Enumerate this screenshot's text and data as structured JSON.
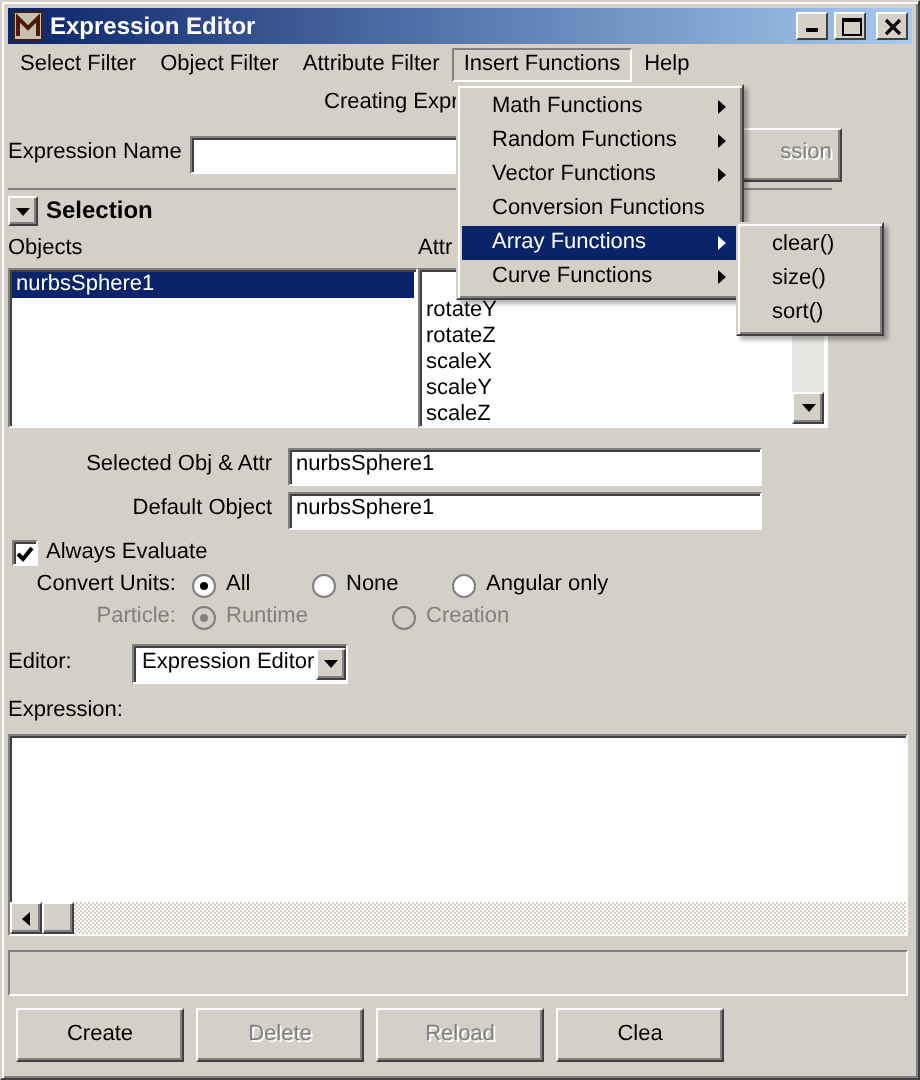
{
  "window": {
    "title": "Expression Editor"
  },
  "menu_bar": [
    {
      "label": "Select Filter",
      "selected": false
    },
    {
      "label": "Object Filter",
      "selected": false
    },
    {
      "label": "Attribute Filter",
      "selected": false
    },
    {
      "label": "Insert Functions",
      "selected": true
    },
    {
      "label": "Help",
      "selected": false
    }
  ],
  "heading": "Creating Expr",
  "expression_name": {
    "label": "Expression Name"
  },
  "action_button": {
    "label": "ssion",
    "disabled": true
  },
  "selection": {
    "title": "Selection",
    "expanded": true
  },
  "objects": {
    "label": "Objects",
    "items": [
      {
        "label": "nurbsSphere1",
        "selected": true
      }
    ]
  },
  "attributes": {
    "label": "Attr",
    "items": [
      {
        "label": "rotateY",
        "selected": false
      },
      {
        "label": "rotateZ",
        "selected": false
      },
      {
        "label": "scaleX",
        "selected": false
      },
      {
        "label": "scaleY",
        "selected": false
      },
      {
        "label": "scaleZ",
        "selected": false
      }
    ]
  },
  "fields": [
    {
      "label": "Selected Obj & Attr",
      "value": "nurbsSphere1"
    },
    {
      "label": "Default Object",
      "value": "nurbsSphere1"
    }
  ],
  "always_evaluate": {
    "label": "Always Evaluate",
    "checked": true
  },
  "convert_units": {
    "label": "Convert Units:",
    "disabled": false,
    "options": [
      {
        "label": "All",
        "selected": true
      },
      {
        "label": "None",
        "selected": false
      },
      {
        "label": "Angular only",
        "selected": false
      }
    ]
  },
  "particle": {
    "label": "Particle:",
    "disabled": true,
    "options": [
      {
        "label": "Runtime",
        "selected": true
      },
      {
        "label": "Creation",
        "selected": false
      }
    ]
  },
  "editor": {
    "label": "Editor:",
    "value": "Expression Editor"
  },
  "expression": {
    "label": "Expression:"
  },
  "buttons": [
    {
      "label": "Create",
      "disabled": false
    },
    {
      "label": "Delete",
      "disabled": true
    },
    {
      "label": "Reload",
      "disabled": true
    },
    {
      "label": "Clea",
      "disabled": false
    }
  ],
  "insert_functions_menu": [
    {
      "label": "Math Functions",
      "selected": false
    },
    {
      "label": "Random Functions",
      "selected": false
    },
    {
      "label": "Vector Functions",
      "selected": false
    },
    {
      "label": "Conversion Functions",
      "selected": false
    },
    {
      "label": "Array Functions",
      "selected": true
    },
    {
      "label": "Curve Functions",
      "selected": false
    }
  ],
  "array_submenu": [
    {
      "label": "clear()"
    },
    {
      "label": "size()"
    },
    {
      "label": "sort()"
    }
  ]
}
